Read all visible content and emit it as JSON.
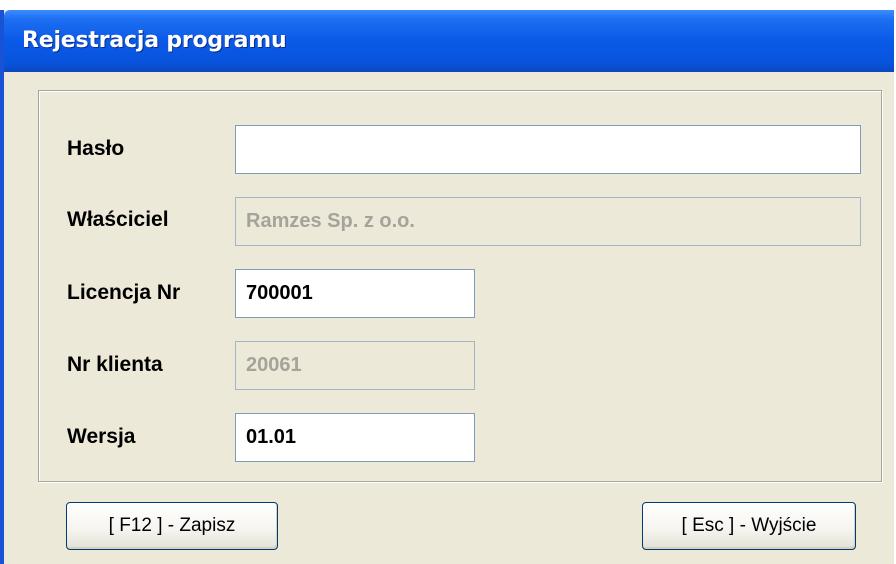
{
  "window": {
    "title": "Rejestracja programu"
  },
  "form": {
    "password": {
      "label": "Hasło",
      "value": ""
    },
    "owner": {
      "label": "Właściciel",
      "value": "Ramzes Sp. z o.o."
    },
    "license": {
      "label": "Licencja Nr",
      "value": "700001"
    },
    "client": {
      "label": "Nr klienta",
      "value": "20061"
    },
    "version": {
      "label": "Wersja",
      "value": "01.01"
    }
  },
  "buttons": {
    "save_label": "[ F12 ] - Zapisz",
    "exit_label": "[ Esc ] - Wyjście"
  },
  "colors": {
    "titlebar": "#0a5ae8",
    "window_bg": "#ece9d8",
    "disabled_text": "#a5a39a"
  }
}
